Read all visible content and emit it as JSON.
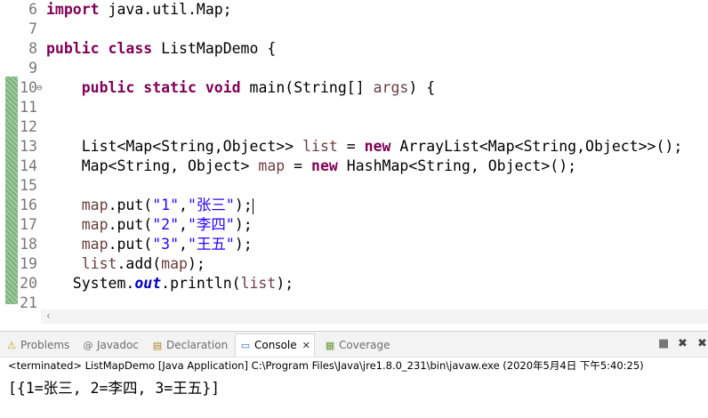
{
  "editor": {
    "lines": [
      {
        "num": "6",
        "segments": [
          {
            "t": "import",
            "c": "kw"
          },
          {
            "t": " java.util.Map;",
            "c": ""
          }
        ]
      },
      {
        "num": "7",
        "segments": []
      },
      {
        "num": "8",
        "segments": [
          {
            "t": "public",
            "c": "kw"
          },
          {
            "t": " ",
            "c": ""
          },
          {
            "t": "class",
            "c": "kw"
          },
          {
            "t": " ListMapDemo {",
            "c": ""
          }
        ]
      },
      {
        "num": "9",
        "segments": []
      },
      {
        "num": "10",
        "fold": "⊖",
        "segments": [
          {
            "t": "    ",
            "c": ""
          },
          {
            "t": "public",
            "c": "kw"
          },
          {
            "t": " ",
            "c": ""
          },
          {
            "t": "static",
            "c": "kw"
          },
          {
            "t": " ",
            "c": ""
          },
          {
            "t": "void",
            "c": "kw"
          },
          {
            "t": " main(String[] ",
            "c": ""
          },
          {
            "t": "args",
            "c": "var"
          },
          {
            "t": ") {",
            "c": ""
          }
        ]
      },
      {
        "num": "11",
        "segments": []
      },
      {
        "num": "12",
        "segments": []
      },
      {
        "num": "13",
        "segments": [
          {
            "t": "    List<Map<String,Object>> ",
            "c": ""
          },
          {
            "t": "list",
            "c": "var"
          },
          {
            "t": " = ",
            "c": ""
          },
          {
            "t": "new",
            "c": "kw"
          },
          {
            "t": " ArrayList<Map<String,Object>>();",
            "c": ""
          }
        ]
      },
      {
        "num": "14",
        "segments": [
          {
            "t": "    Map<String, Object> ",
            "c": ""
          },
          {
            "t": "map",
            "c": "var"
          },
          {
            "t": " = ",
            "c": ""
          },
          {
            "t": "new",
            "c": "kw"
          },
          {
            "t": " HashMap<String, Object>();",
            "c": ""
          }
        ]
      },
      {
        "num": "15",
        "segments": []
      },
      {
        "num": "16",
        "caret": true,
        "segments": [
          {
            "t": "    ",
            "c": ""
          },
          {
            "t": "map",
            "c": "var"
          },
          {
            "t": ".put(",
            "c": ""
          },
          {
            "t": "\"1\"",
            "c": "str"
          },
          {
            "t": ",",
            "c": ""
          },
          {
            "t": "\"张三\"",
            "c": "str"
          },
          {
            "t": ");",
            "c": ""
          }
        ]
      },
      {
        "num": "17",
        "segments": [
          {
            "t": "    ",
            "c": ""
          },
          {
            "t": "map",
            "c": "var"
          },
          {
            "t": ".put(",
            "c": ""
          },
          {
            "t": "\"2\"",
            "c": "str"
          },
          {
            "t": ",",
            "c": ""
          },
          {
            "t": "\"李四\"",
            "c": "str"
          },
          {
            "t": ");",
            "c": ""
          }
        ]
      },
      {
        "num": "18",
        "segments": [
          {
            "t": "    ",
            "c": ""
          },
          {
            "t": "map",
            "c": "var"
          },
          {
            "t": ".put(",
            "c": ""
          },
          {
            "t": "\"3\"",
            "c": "str"
          },
          {
            "t": ",",
            "c": ""
          },
          {
            "t": "\"王五\"",
            "c": "str"
          },
          {
            "t": ");",
            "c": ""
          }
        ]
      },
      {
        "num": "19",
        "segments": [
          {
            "t": "    ",
            "c": ""
          },
          {
            "t": "list",
            "c": "var"
          },
          {
            "t": ".add(",
            "c": ""
          },
          {
            "t": "map",
            "c": "var"
          },
          {
            "t": ");",
            "c": ""
          }
        ]
      },
      {
        "num": "20",
        "segments": [
          {
            "t": "   System.",
            "c": ""
          },
          {
            "t": "out",
            "c": "fld"
          },
          {
            "t": ".println(",
            "c": ""
          },
          {
            "t": "list",
            "c": "var"
          },
          {
            "t": ");",
            "c": ""
          }
        ]
      },
      {
        "num": "21",
        "segments": []
      }
    ],
    "hscroll_arrow": "‹"
  },
  "panel": {
    "tabs": [
      {
        "label": "Problems",
        "icon": "⚠"
      },
      {
        "label": "Javadoc",
        "icon": "@"
      },
      {
        "label": "Declaration",
        "icon": "▤"
      },
      {
        "label": "Console",
        "icon": "▭",
        "active": true,
        "close": "✕"
      },
      {
        "label": "Coverage",
        "icon": "▦"
      }
    ],
    "toolbar": {
      "stop_icon": "■",
      "remove_icon": "✖",
      "remove_all_icon": "✖"
    },
    "status": "<terminated> ListMapDemo [Java Application] C:\\Program Files\\Java\\jre1.8.0_231\\bin\\javaw.exe (2020年5月4日 下午5:40:25)",
    "output": "[{1=张三, 2=李四, 3=王五}]"
  }
}
